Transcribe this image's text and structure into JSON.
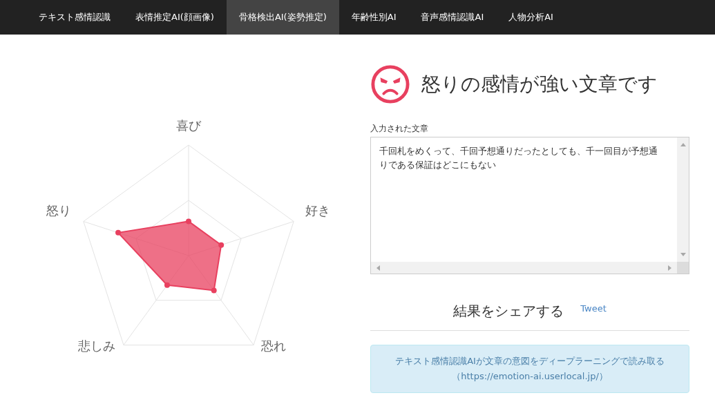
{
  "nav": {
    "tabs": [
      {
        "label": "テキスト感情認識",
        "selected": false
      },
      {
        "label": "表情推定AI(顔画像)",
        "selected": false
      },
      {
        "label": "骨格検出AI(姿勢推定)",
        "selected": true
      },
      {
        "label": "年齢性別AI",
        "selected": false
      },
      {
        "label": "音声感情認識AI",
        "selected": false
      },
      {
        "label": "人物分析AI",
        "selected": false
      }
    ]
  },
  "chart": {
    "labels": [
      "喜び",
      "好き",
      "恐れ",
      "悲しみ",
      "怒り"
    ]
  },
  "result": {
    "title": "怒りの感情が強い文章です"
  },
  "input": {
    "label": "入力された文章",
    "value": "千回札をめくって、千回予想通りだったとしても、千一回目が予想通りである保証はどこにもない"
  },
  "share": {
    "title": "結果をシェアする",
    "tweet": "Tweet"
  },
  "info": {
    "lines": [
      "テキスト感情認識AIが文章の意図をディープラーニングで読み取る",
      "（https://emotion-ai.userlocal.jp/）"
    ]
  }
}
